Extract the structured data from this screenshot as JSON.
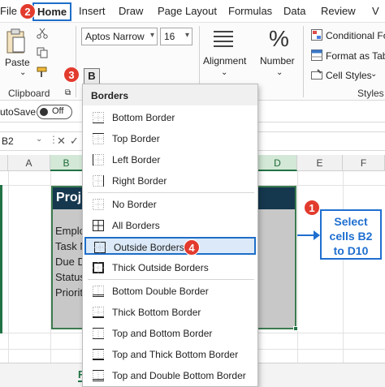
{
  "tabs": [
    "File",
    "Home",
    "Insert",
    "Draw",
    "Page Layout",
    "Formulas",
    "Data",
    "Review",
    "V"
  ],
  "markers": [
    "1",
    "2",
    "3",
    "4"
  ],
  "ribbon": {
    "paste_label": "Paste",
    "clipboard_label": "Clipboard",
    "font_name": "Aptos Narrow",
    "font_size": "16",
    "bold_label": "B",
    "alignment_label": "Alignment",
    "number_label": "Number",
    "percent_glyph": "%",
    "styles_items": [
      "Conditional Fo",
      "Format as Tabl",
      "Cell Styles"
    ],
    "styles_label": "Styles"
  },
  "autosave": {
    "label": "utoSave",
    "toggle_text": "Off"
  },
  "namebox": "B2",
  "columns": [
    "A",
    "B",
    "C",
    "D",
    "E",
    "F"
  ],
  "table": {
    "header_text": "Proj",
    "rows": [
      "Emplo",
      "Task N",
      "Due D",
      "Status",
      "Priorit"
    ]
  },
  "callout": {
    "line1": "Select",
    "line2": "cells B2",
    "line3": "to D10"
  },
  "sheet_tab_partial": "F",
  "dropdown": {
    "title": "Borders",
    "items": [
      {
        "label": "Bottom Border",
        "icon": "bottom-border-icon"
      },
      {
        "label": "Top Border",
        "icon": "top-border-icon"
      },
      {
        "label": "Left Border",
        "icon": "left-border-icon"
      },
      {
        "label": "Right Border",
        "icon": "right-border-icon"
      },
      {
        "label": "No Border",
        "icon": "no-border-icon"
      },
      {
        "label": "All Borders",
        "icon": "all-borders-icon"
      },
      {
        "label": "Outside Borders",
        "icon": "outside-borders-icon"
      },
      {
        "label": "Thick Outside Borders",
        "icon": "thick-outside-borders-icon"
      },
      {
        "label": "Bottom Double Border",
        "icon": "bottom-double-border-icon"
      },
      {
        "label": "Thick Bottom Border",
        "icon": "thick-bottom-border-icon"
      },
      {
        "label": "Top and Bottom Border",
        "icon": "top-bottom-border-icon"
      },
      {
        "label": "Top and Thick Bottom Border",
        "icon": "top-thick-bottom-border-icon"
      },
      {
        "label": "Top and Double Bottom Border",
        "icon": "top-double-bottom-border-icon"
      }
    ]
  },
  "colors": {
    "accent_blue": "#1e6ec8",
    "marker_red": "#e23b2e",
    "table_header": "#15384f",
    "excel_green": "#217346"
  }
}
